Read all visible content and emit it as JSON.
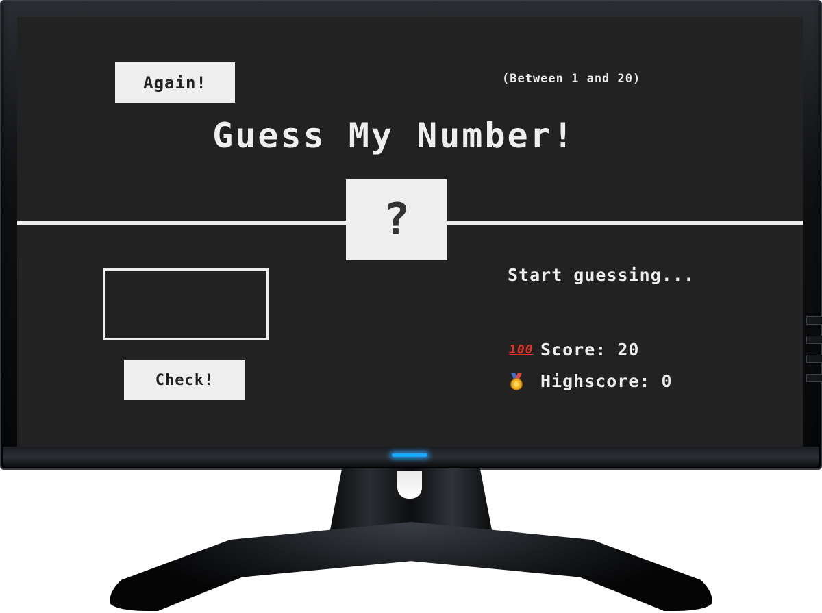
{
  "game": {
    "again_label": "Again!",
    "between_text": "(Between 1 and 20)",
    "title": "Guess My Number!",
    "secret_number": "?",
    "guess_value": "",
    "check_label": "Check!",
    "message": "Start guessing...",
    "score_label": "Score:",
    "score_value": "20",
    "highscore_label": "Highscore:",
    "highscore_value": "0",
    "score_icon": "hundred-points-icon",
    "highscore_icon": "medal-icon"
  },
  "colors": {
    "background": "#222222",
    "foreground": "#eeeeee",
    "power_led": "#19a8ff"
  }
}
